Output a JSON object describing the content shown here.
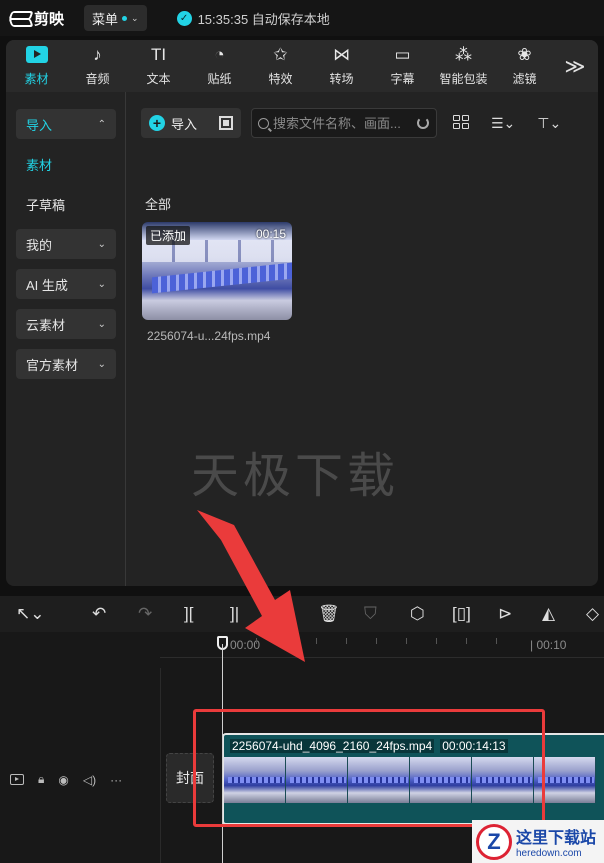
{
  "titlebar": {
    "app_name": "剪映",
    "menu_label": "菜单",
    "save_status": "15:35:35 自动保存本地"
  },
  "toolbar": {
    "tools": [
      {
        "label": "素材",
        "icon": "media-icon",
        "active": true
      },
      {
        "label": "音频",
        "icon": "audio-icon"
      },
      {
        "label": "文本",
        "icon": "text-icon",
        "glyph": "TI"
      },
      {
        "label": "贴纸",
        "icon": "sticker-icon"
      },
      {
        "label": "特效",
        "icon": "effects-icon"
      },
      {
        "label": "转场",
        "icon": "transition-icon"
      },
      {
        "label": "字幕",
        "icon": "subtitle-icon"
      },
      {
        "label": "智能包装",
        "icon": "smart-package-icon"
      },
      {
        "label": "滤镜",
        "icon": "filter-icon"
      }
    ],
    "more_glyph": "≫"
  },
  "sidebar": {
    "items": [
      {
        "label": "导入",
        "style": "sel",
        "chevron": "⌃"
      },
      {
        "label": "素材",
        "style": "cyan"
      },
      {
        "label": "子草稿",
        "style": "plain"
      },
      {
        "label": "我的",
        "style": "box",
        "chevron": "⌄"
      },
      {
        "label": "AI 生成",
        "style": "box",
        "chevron": "⌄"
      },
      {
        "label": "云素材",
        "style": "box",
        "chevron": "⌄"
      },
      {
        "label": "官方素材",
        "style": "box",
        "chevron": "⌄"
      }
    ]
  },
  "content": {
    "import_label": "导入",
    "search_placeholder": "搜索文件名称、画面...",
    "section_label": "全部",
    "media": {
      "added_badge": "已添加",
      "duration": "00:15",
      "filename": "2256074-u...24fps.mp4"
    },
    "watermark": "天极下载"
  },
  "timeline": {
    "ruler": {
      "start_label": "00:00",
      "mark_label": "| 00:10"
    },
    "cover_label": "封面",
    "clip": {
      "name": "2256074-uhd_4096_2160_24fps.mp4",
      "duration": "00:00:14:13"
    }
  },
  "site_badge": {
    "main": "这里下载站",
    "sub": "heredown.com"
  },
  "colors": {
    "accent": "#22d3e5",
    "highlight_box": "#ea3b3b",
    "arrow": "#ea3b3b"
  }
}
